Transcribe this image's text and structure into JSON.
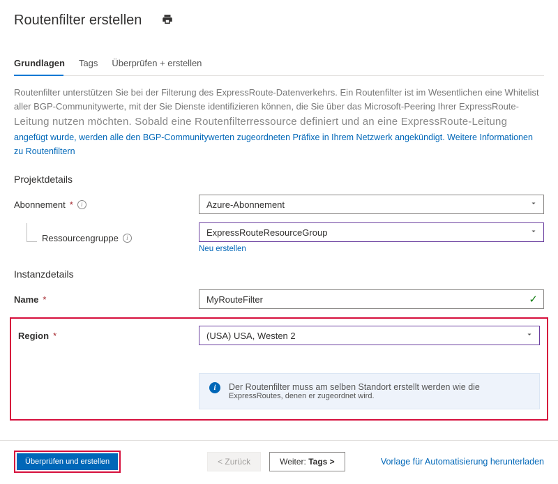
{
  "header": {
    "title": "Routenfilter erstellen"
  },
  "tabs": {
    "basics": "Grundlagen",
    "tags": "Tags",
    "review": "Überprüfen + erstellen"
  },
  "description": {
    "p1": "Routenfilter unterstützen Sie bei der Filterung des ExpressRoute-Datenverkehrs. Ein Routenfilter ist im Wesentlichen eine Whitelist aller BGP-Communitywerte, mit der Sie Dienste identifizieren können, die Sie über das Microsoft-Peering Ihrer ExpressRoute-",
    "p2": "Leitung nutzen möchten. Sobald eine Routenfilterressource definiert und an eine ExpressRoute-Leitung",
    "p3": "angefügt wurde, werden alle den BGP-Communitywerten zugeordneten Präfixe in Ihrem Netzwerk angekündigt. Weitere Informationen zu Routenfiltern"
  },
  "sections": {
    "project": "Projektdetails",
    "instance": "Instanzdetails"
  },
  "labels": {
    "subscription": "Abonnement",
    "resourceGroup": "Ressourcengruppe",
    "name": "Name",
    "region": "Region"
  },
  "values": {
    "subscription": "Azure-Abonnement",
    "resourceGroup": "ExpressRouteResourceGroup",
    "name": "MyRouteFilter",
    "region": "(USA) USA, Westen 2"
  },
  "links": {
    "newResourceGroup": "Neu erstellen",
    "automationTemplate": "Vorlage für Automatisierung herunterladen"
  },
  "info": {
    "line1": "Der Routenfilter muss am selben Standort erstellt werden wie die",
    "line2": "ExpressRoutes, denen er zugeordnet wird."
  },
  "footer": {
    "review": "Überprüfen und erstellen",
    "back": "< Zurück",
    "nextPrefix": "Weiter:",
    "nextTarget": "Tags >"
  }
}
